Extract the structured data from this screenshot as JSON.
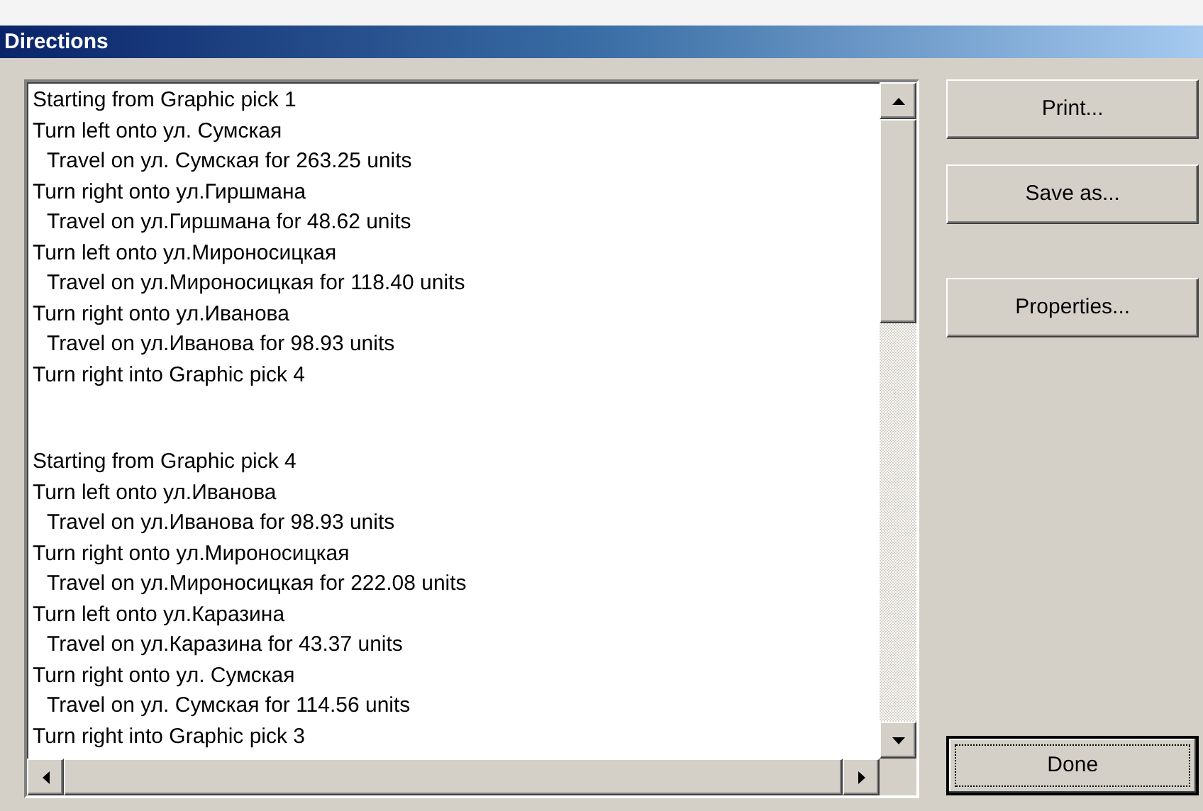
{
  "window": {
    "title": "Directions"
  },
  "routes": [
    {
      "lines": [
        {
          "kind": "step",
          "text": "Starting from Graphic pick 1"
        },
        {
          "kind": "step",
          "text": "Turn left onto ул. Сумская"
        },
        {
          "kind": "travel",
          "text": "Travel on ул. Сумская for 263.25 units"
        },
        {
          "kind": "step",
          "text": "Turn right onto ул.Гиршмана"
        },
        {
          "kind": "travel",
          "text": "Travel on ул.Гиршмана for 48.62 units"
        },
        {
          "kind": "step",
          "text": "Turn left onto ул.Мироносицкая"
        },
        {
          "kind": "travel",
          "text": "Travel on ул.Мироносицкая for 118.40 units"
        },
        {
          "kind": "step",
          "text": "Turn right onto ул.Иванова"
        },
        {
          "kind": "travel",
          "text": "Travel on ул.Иванова for 98.93 units"
        },
        {
          "kind": "step",
          "text": "Turn right into Graphic pick 4"
        }
      ]
    },
    {
      "lines": [
        {
          "kind": "step",
          "text": "Starting from Graphic pick 4"
        },
        {
          "kind": "step",
          "text": "Turn left onto ул.Иванова"
        },
        {
          "kind": "travel",
          "text": "Travel on ул.Иванова for 98.93 units"
        },
        {
          "kind": "step",
          "text": "Turn right onto ул.Мироносицкая"
        },
        {
          "kind": "travel",
          "text": "Travel on ул.Мироносицкая for 222.08 units"
        },
        {
          "kind": "step",
          "text": "Turn left onto ул.Каразина"
        },
        {
          "kind": "travel",
          "text": "Travel on ул.Каразина for 43.37 units"
        },
        {
          "kind": "step",
          "text": "Turn right onto ул. Сумская"
        },
        {
          "kind": "travel",
          "text": "Travel on ул. Сумская for 114.56 units"
        },
        {
          "kind": "step",
          "text": "Turn right into Graphic pick 3"
        }
      ]
    }
  ],
  "button_groups": [
    {
      "buttons": [
        {
          "label": "Print...",
          "default": false
        },
        {
          "label": "Save as...",
          "default": false
        }
      ]
    },
    {
      "buttons": [
        {
          "label": "Properties...",
          "default": false
        }
      ]
    },
    {
      "buttons": [
        {
          "label": "Done",
          "default": true
        }
      ]
    }
  ]
}
